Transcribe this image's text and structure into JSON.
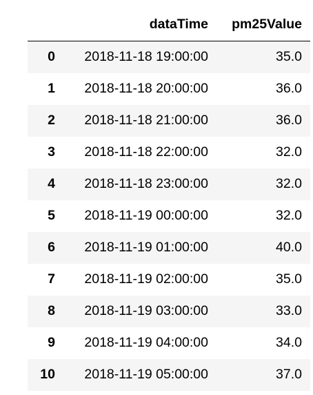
{
  "table": {
    "columns": [
      "dataTime",
      "pm25Value"
    ],
    "rows": [
      {
        "index": "0",
        "dataTime": "2018-11-18 19:00:00",
        "pm25Value": "35.0"
      },
      {
        "index": "1",
        "dataTime": "2018-11-18 20:00:00",
        "pm25Value": "36.0"
      },
      {
        "index": "2",
        "dataTime": "2018-11-18 21:00:00",
        "pm25Value": "36.0"
      },
      {
        "index": "3",
        "dataTime": "2018-11-18 22:00:00",
        "pm25Value": "32.0"
      },
      {
        "index": "4",
        "dataTime": "2018-11-18 23:00:00",
        "pm25Value": "32.0"
      },
      {
        "index": "5",
        "dataTime": "2018-11-19 00:00:00",
        "pm25Value": "32.0"
      },
      {
        "index": "6",
        "dataTime": "2018-11-19 01:00:00",
        "pm25Value": "40.0"
      },
      {
        "index": "7",
        "dataTime": "2018-11-19 02:00:00",
        "pm25Value": "35.0"
      },
      {
        "index": "8",
        "dataTime": "2018-11-19 03:00:00",
        "pm25Value": "33.0"
      },
      {
        "index": "9",
        "dataTime": "2018-11-19 04:00:00",
        "pm25Value": "34.0"
      },
      {
        "index": "10",
        "dataTime": "2018-11-19 05:00:00",
        "pm25Value": "37.0"
      }
    ]
  },
  "colors": {
    "striped_row": "#f5f5f5",
    "header_border": "#000000",
    "text": "#000000"
  }
}
